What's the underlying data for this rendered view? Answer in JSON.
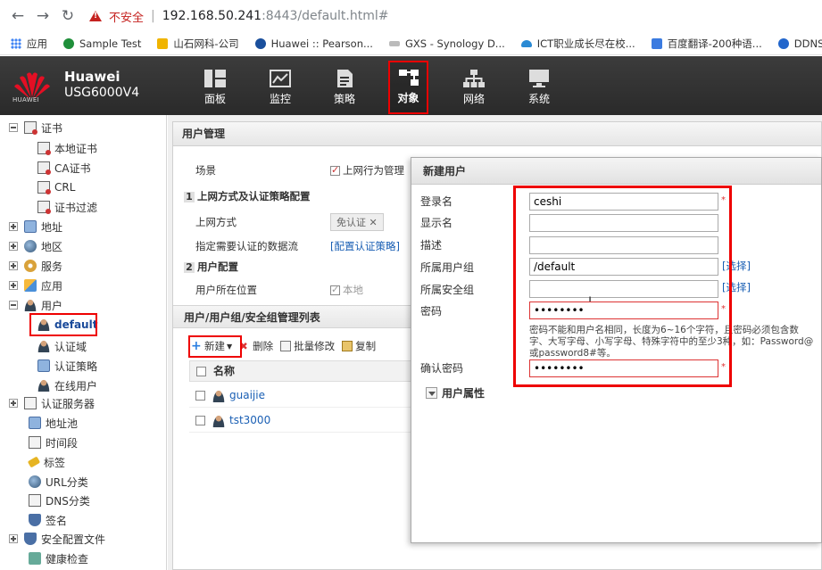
{
  "browser": {
    "insecure_label": "不安全",
    "url_host": "192.168.50.241",
    "url_rest": ":8443/default.html#",
    "bookmarks": [
      {
        "label": "应用",
        "color": "#4285f4"
      },
      {
        "label": "Sample Test",
        "color": "#1f8f3a"
      },
      {
        "label": "山石网科-公司",
        "color": "#f0b400"
      },
      {
        "label": "Huawei :: Pearson...",
        "color": "#1a4f9c"
      },
      {
        "label": "GXS - Synology D...",
        "color": "#888888"
      },
      {
        "label": "ICT职业成长尽在校...",
        "color": "#2a8ad4"
      },
      {
        "label": "百度翻译-200种语...",
        "color": "#3b7be0"
      },
      {
        "label": "DDNS",
        "color": "#2266cc"
      }
    ]
  },
  "header": {
    "brand": "Huawei",
    "model": "USG6000V4",
    "logo_text": "HUAWEI",
    "modules": [
      {
        "label": "面板",
        "icon": "dashboard-icon"
      },
      {
        "label": "监控",
        "icon": "monitor-icon"
      },
      {
        "label": "策略",
        "icon": "policy-icon"
      },
      {
        "label": "对象",
        "icon": "object-icon",
        "active": true
      },
      {
        "label": "网络",
        "icon": "network-icon"
      },
      {
        "label": "系统",
        "icon": "system-icon"
      }
    ]
  },
  "sidebar": {
    "items": [
      {
        "label": "证书",
        "icon": "cert-icon",
        "expander": "minus"
      },
      {
        "label": "本地证书",
        "icon": "local-cert-icon"
      },
      {
        "label": "CA证书",
        "icon": "ca-cert-icon"
      },
      {
        "label": "CRL",
        "icon": "crl-icon"
      },
      {
        "label": "证书过滤",
        "icon": "cert-filter-icon"
      },
      {
        "label": "地址",
        "icon": "address-icon",
        "expander": "plus"
      },
      {
        "label": "地区",
        "icon": "region-icon",
        "expander": "plus"
      },
      {
        "label": "服务",
        "icon": "service-icon",
        "expander": "plus"
      },
      {
        "label": "应用",
        "icon": "application-icon",
        "expander": "plus"
      },
      {
        "label": "用户",
        "icon": "user-icon",
        "expander": "minus"
      },
      {
        "label": "default",
        "icon": "default-user-icon",
        "selected": true
      },
      {
        "label": "认证域",
        "icon": "auth-domain-icon"
      },
      {
        "label": "认证策略",
        "icon": "auth-policy-icon"
      },
      {
        "label": "在线用户",
        "icon": "online-user-icon"
      },
      {
        "label": "认证服务器",
        "icon": "auth-server-icon",
        "expander": "plus"
      },
      {
        "label": "地址池",
        "icon": "address-pool-icon"
      },
      {
        "label": "时间段",
        "icon": "time-range-icon"
      },
      {
        "label": "标签",
        "icon": "tag-icon"
      },
      {
        "label": "URL分类",
        "icon": "url-category-icon"
      },
      {
        "label": "DNS分类",
        "icon": "dns-category-icon"
      },
      {
        "label": "签名",
        "icon": "signature-icon"
      },
      {
        "label": "安全配置文件",
        "icon": "security-profile-icon",
        "expander": "plus"
      },
      {
        "label": "健康检查",
        "icon": "health-check-icon"
      }
    ]
  },
  "main": {
    "panel_title": "用户管理",
    "scene_label": "场景",
    "scene_option": "上网行为管理",
    "section1_num": "1",
    "section1_title": "上网方式及认证策略配置",
    "access_label": "上网方式",
    "access_value": "免认证",
    "auth_flow_label": "指定需要认证的数据流",
    "auth_flow_link": "[配置认证策略]",
    "section2_num": "2",
    "section2_title": "用户配置",
    "location_label": "用户所在位置",
    "location_value": "本地",
    "list_title": "用户/用户组/安全组管理列表",
    "toolbar": {
      "new": "新建",
      "delete": "删除",
      "batch_edit": "批量修改",
      "copy": "复制"
    },
    "table_header": "名称",
    "rows": [
      "guaijie",
      "tst3000"
    ]
  },
  "dialog": {
    "title": "新建用户",
    "login_label": "登录名",
    "login_value": "ceshi",
    "display_label": "显示名",
    "desc_label": "描述",
    "group_label": "所属用户组",
    "group_value": "/default",
    "secgroup_label": "所属安全组",
    "select_link": "[选择]",
    "password_label": "密码",
    "password_value": "••••••••",
    "confirm_label": "确认密码",
    "confirm_value": "••••••••",
    "hint": "密码不能和用户名相同，长度为6~16个字符，且密码必须包含数字、大写字母、小写字母、特殊字符中的至少3种，如：Password@或password8#等。",
    "user_attr": "用户属性"
  }
}
